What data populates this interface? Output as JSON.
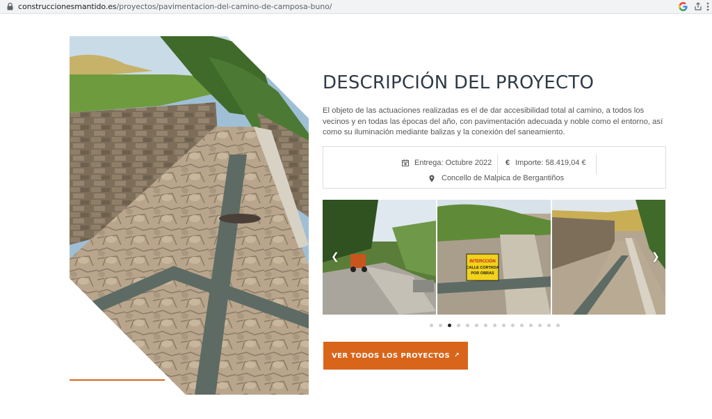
{
  "browser": {
    "url_domain": "construccionesmantido.es",
    "url_path": "/proyectos/pavimentacion-del-camino-de-camposa-buno/",
    "icons": [
      "lock-icon",
      "google-icon",
      "share-icon",
      "more-icon"
    ]
  },
  "project": {
    "title": "DESCRIPCIÓN DEL PROYECTO",
    "description": "El objeto de las actuaciones realizadas es el de dar accesibilidad total al camino, a todos los vecinos y en todas las épocas del año, con pavimentación adecuada y noble como el entorno, así como su iluminación mediante balizas y la conexión del saneamiento.",
    "delivery": "Entrega: Octubre 2022",
    "amount": "Importe: 58.419,04 €",
    "amount_symbol": "€",
    "location": "Concello de Malpica de Bergantiños"
  },
  "gallery": {
    "slide_count": 15,
    "active_index": 2,
    "sign_line1": "INTERCCIÓN",
    "sign_line2": "CALLE CORTADA",
    "sign_line3": "POR OBRAS"
  },
  "cta": {
    "label": "VER TODOS LOS PROYECTOS",
    "icon": "↗"
  },
  "colors": {
    "accent": "#d9651b",
    "title": "#2f3a45"
  }
}
